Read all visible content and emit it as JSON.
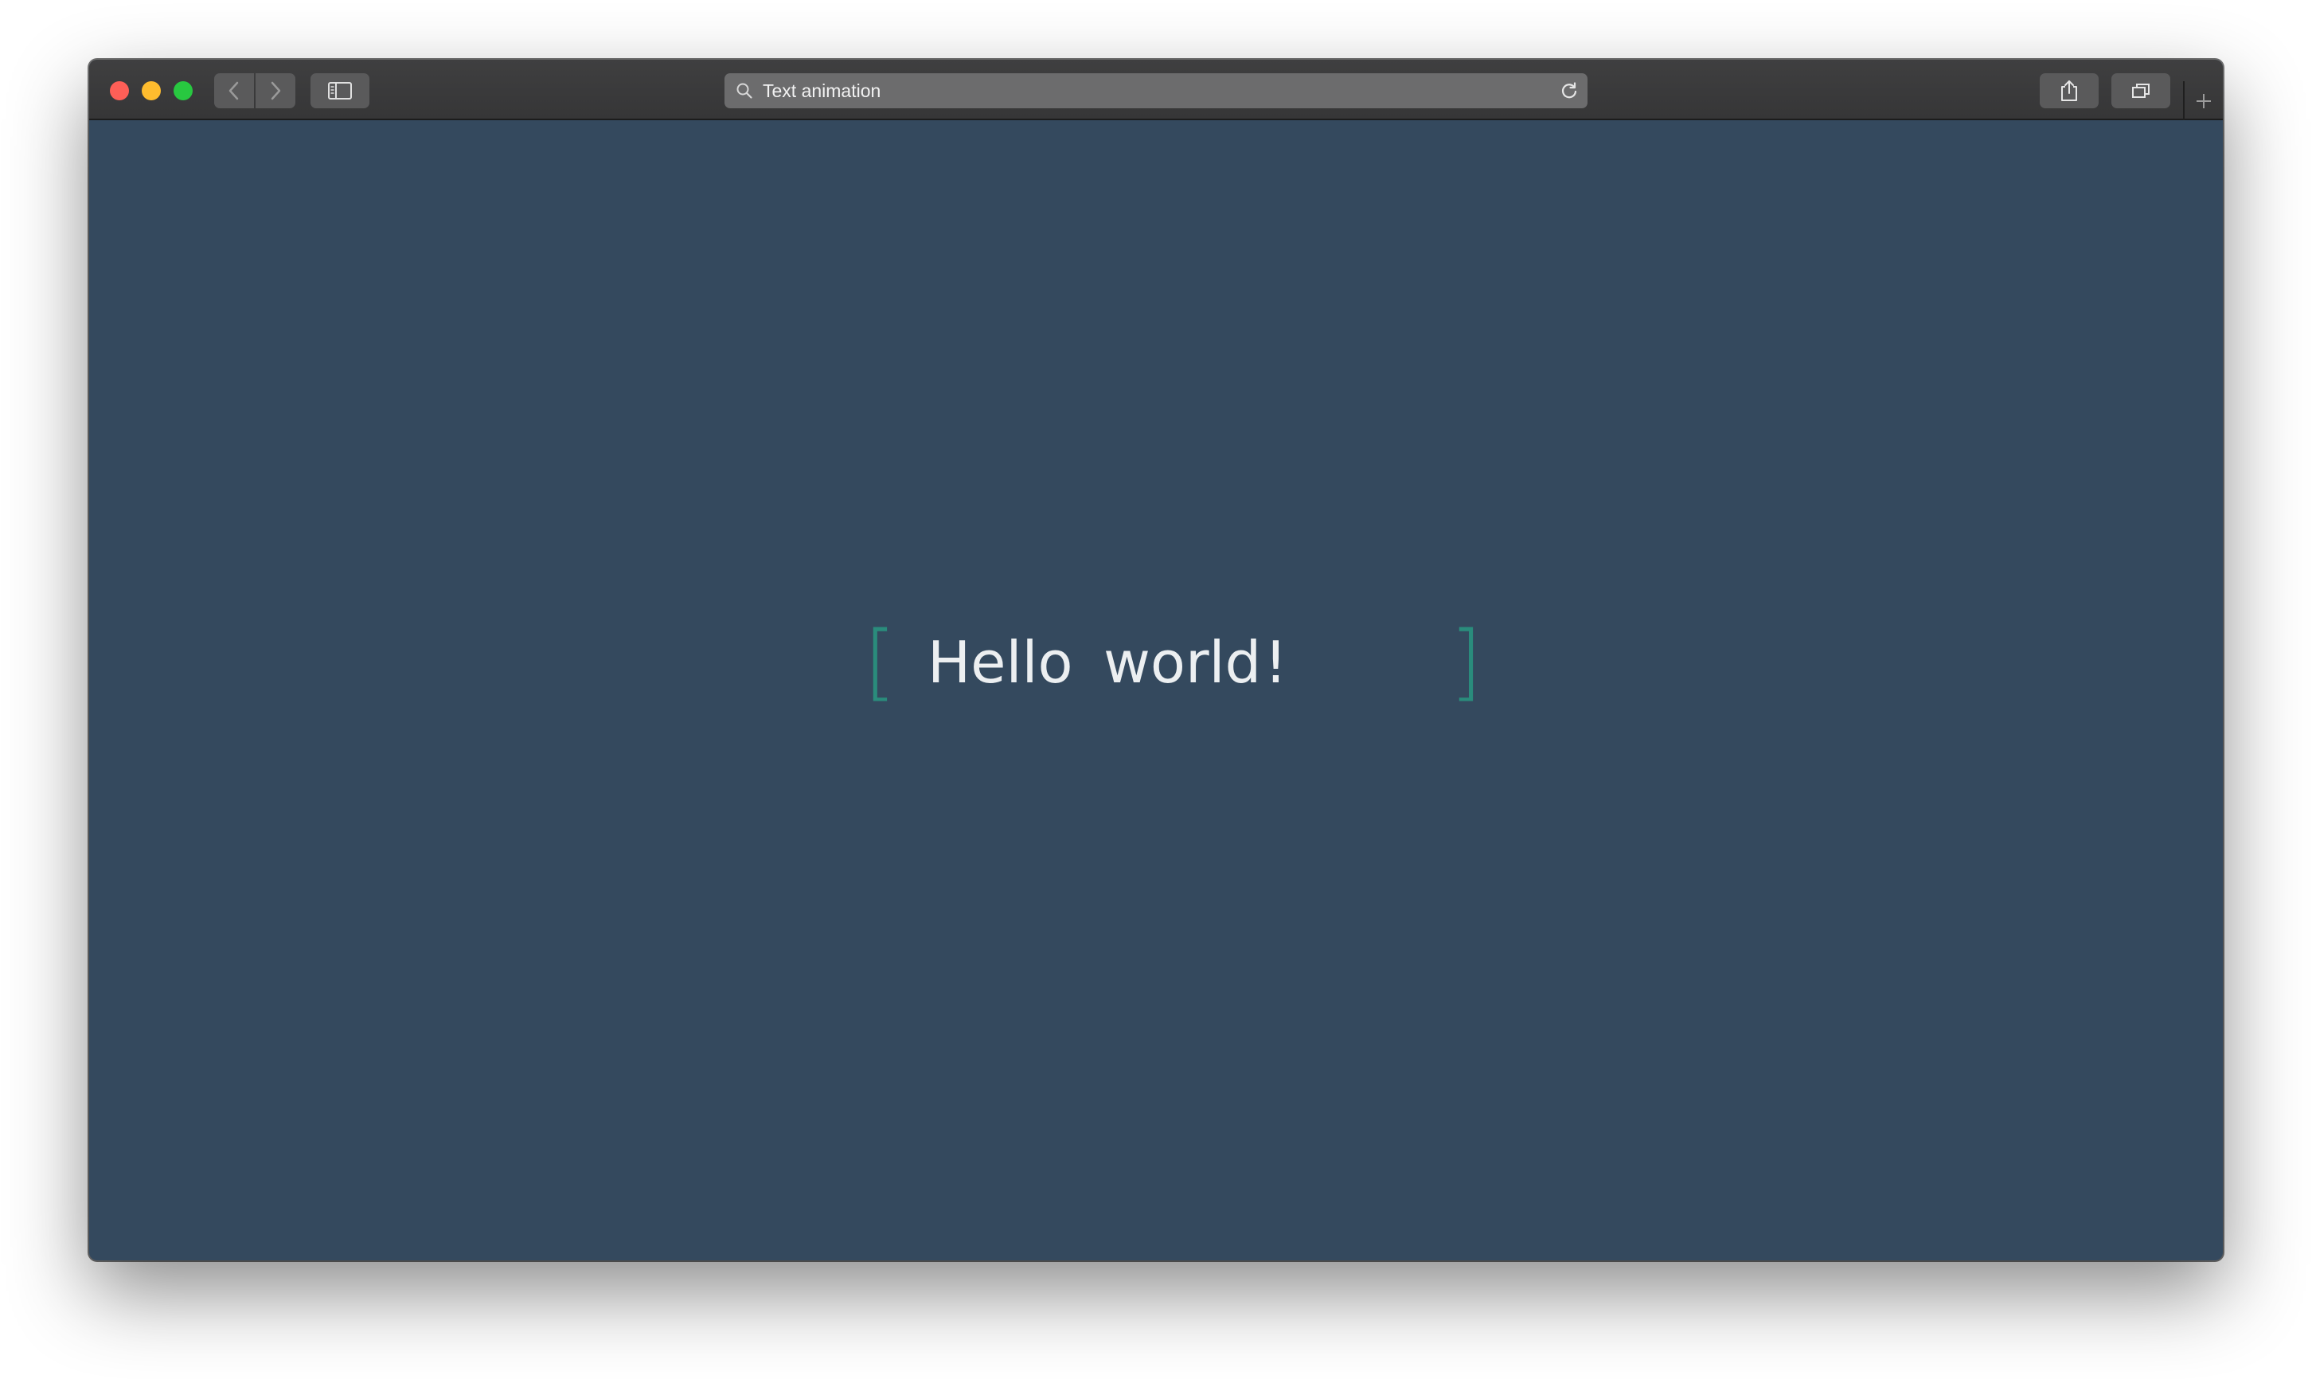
{
  "browser": {
    "url_text": "Text animation",
    "colors": {
      "close": "#fe5f57",
      "minimize": "#febc2e",
      "zoom": "#28c840"
    }
  },
  "content": {
    "background": "#34495e",
    "accent": "#2a8c7c",
    "bracket_left": "[",
    "bracket_right": "]",
    "words": [
      "Hello",
      "world",
      "!"
    ]
  }
}
